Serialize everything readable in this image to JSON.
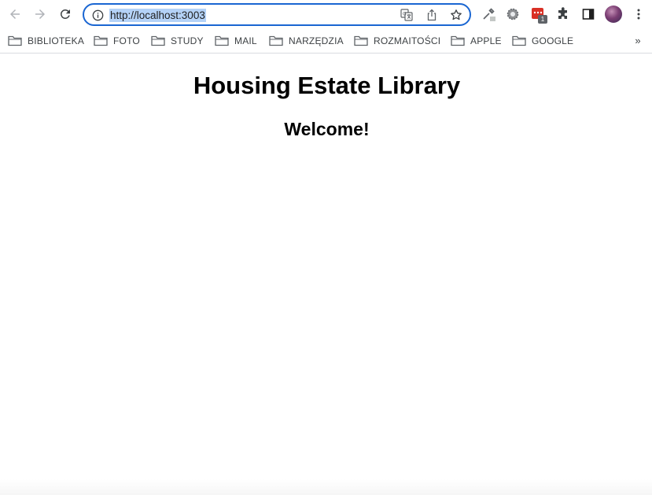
{
  "browser": {
    "url": "http://localhost:3003",
    "extension_badge": "1"
  },
  "bookmarks": [
    {
      "label": "BIBLIOTEKA"
    },
    {
      "label": "FOTO"
    },
    {
      "label": "STUDY"
    },
    {
      "label": "MAIL"
    },
    {
      "label": "NARZĘDZIA"
    },
    {
      "label": "ROZMAITOŚCI"
    },
    {
      "label": "APPLE"
    },
    {
      "label": "GOOGLE"
    }
  ],
  "bookmarks_overflow": "»",
  "page": {
    "title": "Housing Estate Library",
    "subtitle": "Welcome!"
  },
  "colors": {
    "omnibox_border": "#1a66d2",
    "url_selection": "#b4d2f7",
    "extension_red": "#d93025"
  }
}
